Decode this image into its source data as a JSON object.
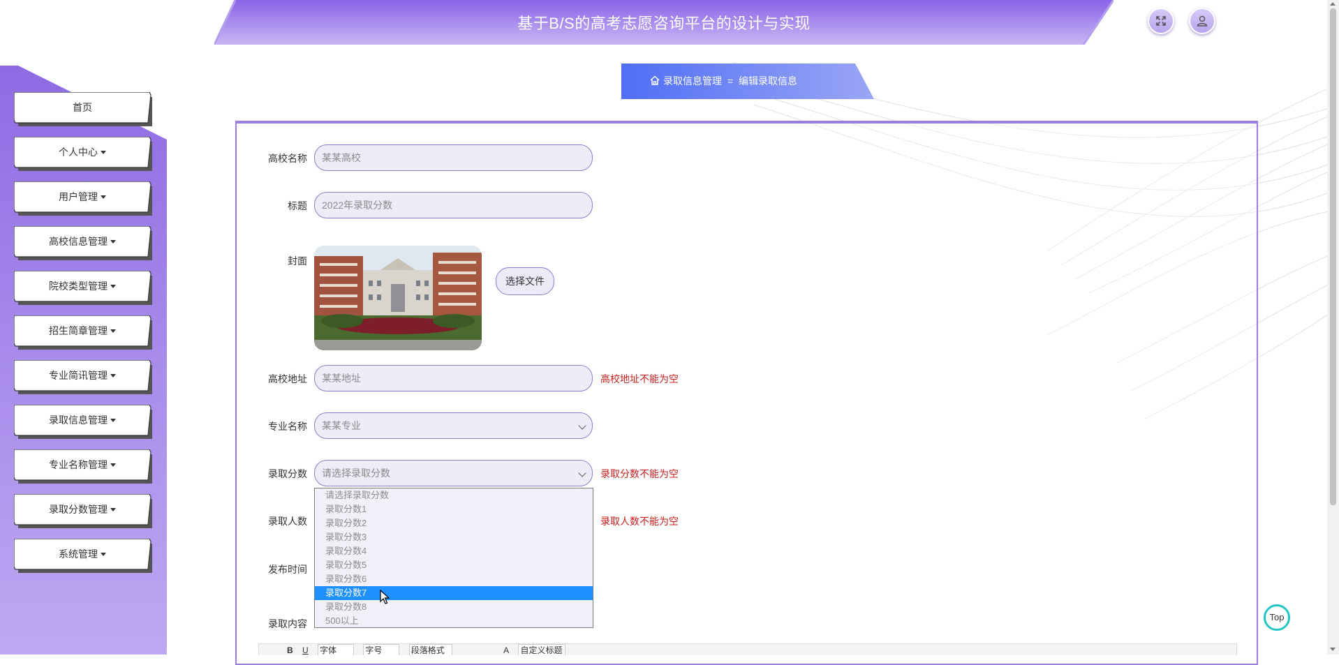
{
  "header": {
    "title": "基于B/S的高考志愿咨询平台的设计与实现"
  },
  "icons": {
    "fullscreen": "expand-icon",
    "user": "user-icon",
    "home": "home-icon"
  },
  "breadcrumb": {
    "section": "录取信息管理",
    "separator": "=",
    "page": "编辑录取信息"
  },
  "sidebar": {
    "items": [
      {
        "label": "首页",
        "has_caret": false
      },
      {
        "label": "个人中心",
        "has_caret": true
      },
      {
        "label": "用户管理",
        "has_caret": true
      },
      {
        "label": "高校信息管理",
        "has_caret": true
      },
      {
        "label": "院校类型管理",
        "has_caret": true
      },
      {
        "label": "招生简章管理",
        "has_caret": true
      },
      {
        "label": "专业简讯管理",
        "has_caret": true
      },
      {
        "label": "录取信息管理",
        "has_caret": true
      },
      {
        "label": "专业名称管理",
        "has_caret": true
      },
      {
        "label": "录取分数管理",
        "has_caret": true
      },
      {
        "label": "系统管理",
        "has_caret": true
      }
    ]
  },
  "form": {
    "school_name": {
      "label": "高校名称",
      "value": "某某高校"
    },
    "title": {
      "label": "标题",
      "value": "2022年录取分数"
    },
    "cover": {
      "label": "封面",
      "choose_file": "选择文件"
    },
    "address": {
      "label": "高校地址",
      "value": "某某地址",
      "error": "高校地址不能为空"
    },
    "major": {
      "label": "专业名称",
      "value": "某某专业"
    },
    "score": {
      "label": "录取分数",
      "value": "请选择录取分数",
      "error": "录取分数不能为空"
    },
    "count": {
      "label": "录取人数",
      "error": "录取人数不能为空"
    },
    "publish_time": {
      "label": "发布时间"
    },
    "content": {
      "label": "录取内容"
    }
  },
  "score_dropdown": {
    "options": [
      "请选择录取分数",
      "录取分数1",
      "录取分数2",
      "录取分数3",
      "录取分数4",
      "录取分数5",
      "录取分数6",
      "录取分数7",
      "录取分数8",
      "500以上"
    ],
    "highlighted": "录取分数7"
  },
  "editor_toolbar": {
    "font": "字体",
    "size": "字号",
    "paragraph": "段落格式",
    "custom_title": "自定义标题"
  },
  "colors": {
    "accent": "#9b7be6",
    "sidebar": "#9f82e6",
    "highlight": "#1e90ff",
    "error": "#c81e1e",
    "top_ring": "#1fc5c5"
  },
  "back_to_top": "Top"
}
